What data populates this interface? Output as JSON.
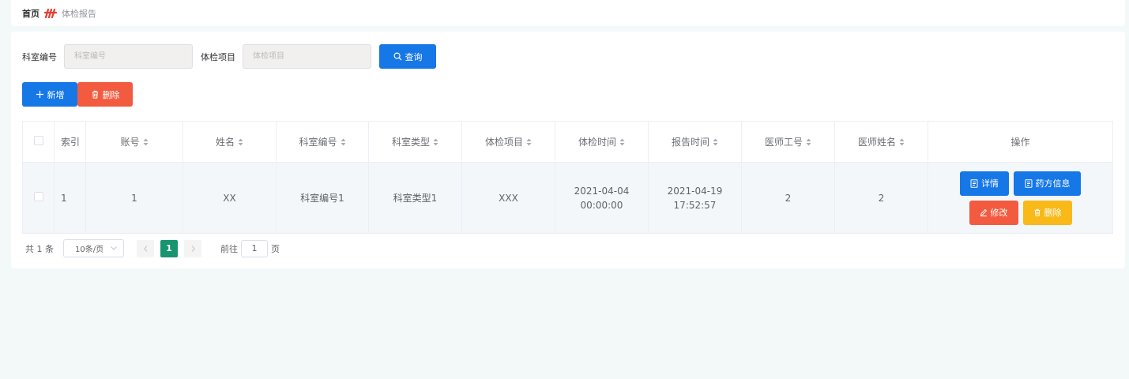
{
  "breadcrumb": {
    "home": "首页",
    "current": "体检报告"
  },
  "search": {
    "dept_label": "科室编号",
    "dept_placeholder": "科室编号",
    "item_label": "体检项目",
    "item_placeholder": "体检项目",
    "query_label": "查询"
  },
  "actions": {
    "add_label": "新增",
    "delete_label": "删除"
  },
  "table": {
    "headers": [
      "索引",
      "账号",
      "姓名",
      "科室编号",
      "科室类型",
      "体检项目",
      "体检时间",
      "报告时间",
      "医师工号",
      "医师姓名",
      "操作"
    ],
    "rows": [
      {
        "index": "1",
        "account": "1",
        "name": "XX",
        "dept_no": "科室编号1",
        "dept_type": "科室类型1",
        "item": "XXX",
        "exam_time": "2021-04-04 00:00:00",
        "report_time": "2021-04-19 17:52:57",
        "doctor_no": "2",
        "doctor_name": "2",
        "ops": {
          "detail": "详情",
          "prescription": "药方信息",
          "edit": "修改",
          "delete": "删除"
        }
      }
    ]
  },
  "pagination": {
    "total": "共 1 条",
    "page_size": "10条/页",
    "current_page": "1",
    "goto_label": "前往",
    "goto_value": "1",
    "page_suffix": "页"
  },
  "colors": {
    "primary": "#1677e6",
    "danger": "#f25b40",
    "warning": "#f8b919",
    "page_active": "#16956f"
  }
}
